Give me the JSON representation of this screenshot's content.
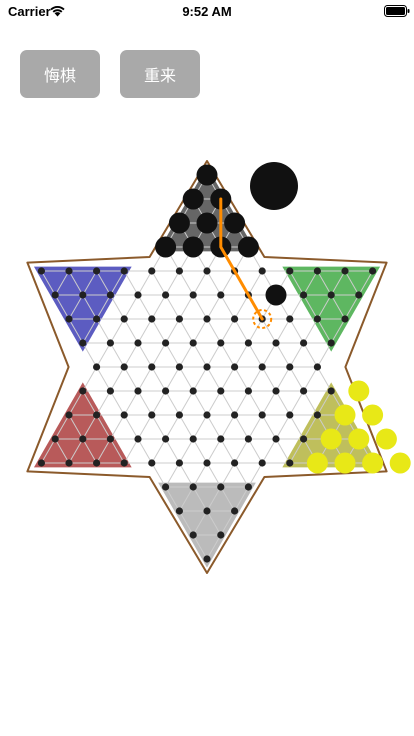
{
  "status_bar": {
    "carrier": "Carrier",
    "time": "9:52 AM",
    "wifi_icon": "wifi-icon",
    "battery_icon": "battery-icon"
  },
  "toolbar": {
    "undo_label": "悔棋",
    "restart_label": "重来",
    "button_color": "#a9a9a9"
  },
  "game": {
    "type": "chinese-checkers",
    "current_turn": "black",
    "colors": {
      "board_outline": "#8b5a2b",
      "grid_lines": "#cccccc",
      "empty_hole": "#222222",
      "black_piece": "#111111",
      "yellow_piece": "#e8e817",
      "move_path": "#ff8c00",
      "zone_top": "#555555",
      "zone_upper_left": "#4a4aba",
      "zone_upper_right": "#4caf50",
      "zone_lower_left": "#b04848",
      "zone_lower_right": "#b8b84a",
      "zone_bottom": "#b4b4b4"
    },
    "pieces": {
      "black": [
        [
          0,
          0
        ],
        [
          1,
          0
        ],
        [
          1,
          1
        ],
        [
          2,
          0
        ],
        [
          2,
          1
        ],
        [
          2,
          2
        ],
        [
          3,
          0
        ],
        [
          3,
          1
        ],
        [
          3,
          2
        ],
        [
          3,
          3
        ],
        [
          5,
          8
        ]
      ],
      "yellow": [
        [
          9,
          10
        ],
        [
          10,
          10
        ],
        [
          10,
          11
        ],
        [
          11,
          10
        ],
        [
          11,
          11
        ],
        [
          11,
          12
        ],
        [
          12,
          10
        ],
        [
          12,
          11
        ],
        [
          12,
          12
        ],
        [
          12,
          13
        ]
      ]
    },
    "moved_from": [
      6,
      7
    ],
    "move_path": [
      [
        1,
        1
      ],
      [
        3,
        2
      ],
      [
        6,
        7
      ]
    ]
  }
}
